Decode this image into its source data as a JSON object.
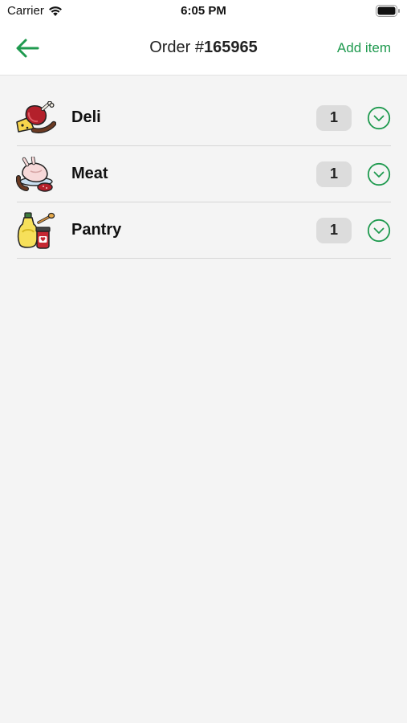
{
  "status_bar": {
    "carrier": "Carrier",
    "time": "6:05 PM"
  },
  "nav": {
    "title_prefix": "Order #",
    "order_number": "165965",
    "add_item_label": "Add item",
    "accent_color": "#1f9a4f"
  },
  "categories": [
    {
      "label": "Deli",
      "quantity": "1",
      "icon": "deli-icon"
    },
    {
      "label": "Meat",
      "quantity": "1",
      "icon": "meat-icon"
    },
    {
      "label": "Pantry",
      "quantity": "1",
      "icon": "pantry-icon"
    }
  ]
}
